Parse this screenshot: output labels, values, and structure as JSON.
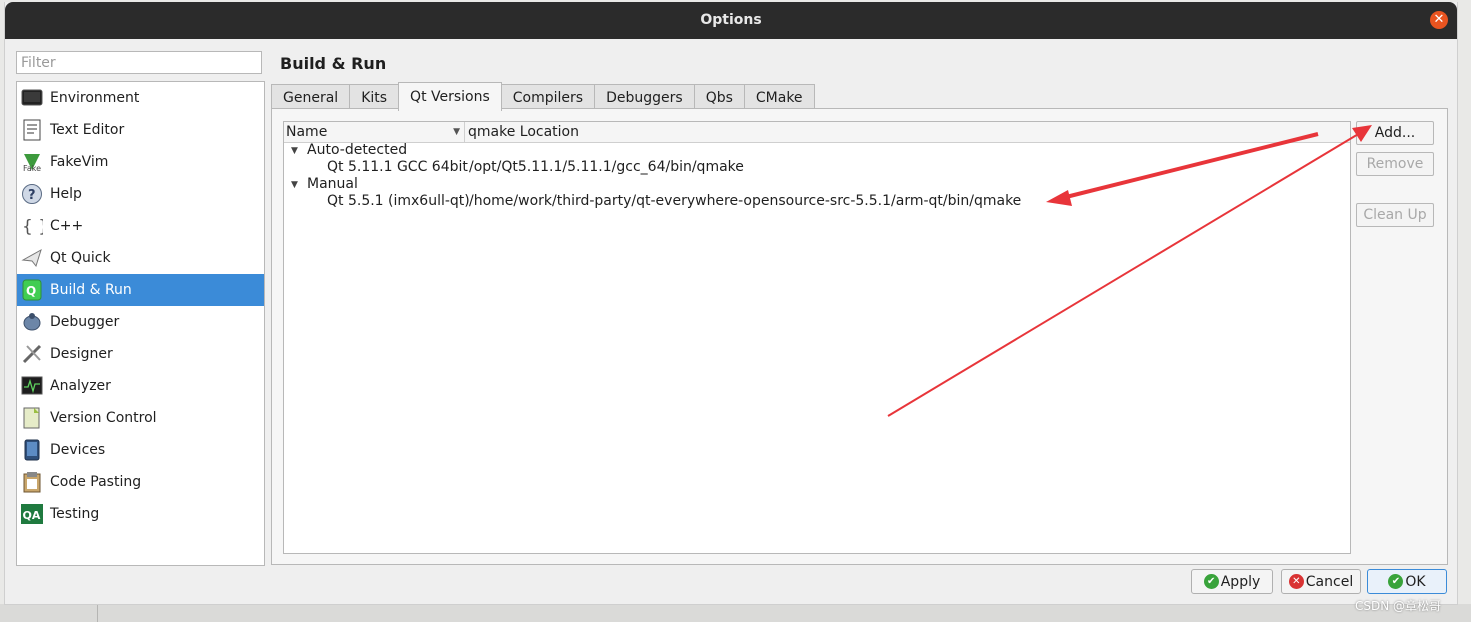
{
  "window": {
    "title": "Options"
  },
  "filter": {
    "placeholder": "Filter"
  },
  "nav": {
    "items": [
      {
        "label": "Environment",
        "icon": "monitor-icon"
      },
      {
        "label": "Text Editor",
        "icon": "text-document-icon"
      },
      {
        "label": "FakeVim",
        "icon": "fakevim-icon"
      },
      {
        "label": "Help",
        "icon": "help-icon"
      },
      {
        "label": "C++",
        "icon": "braces-icon"
      },
      {
        "label": "Qt Quick",
        "icon": "paper-plane-icon"
      },
      {
        "label": "Build & Run",
        "icon": "qt-build-icon"
      },
      {
        "label": "Debugger",
        "icon": "bug-icon"
      },
      {
        "label": "Designer",
        "icon": "drafting-tools-icon"
      },
      {
        "label": "Analyzer",
        "icon": "oscilloscope-icon"
      },
      {
        "label": "Version Control",
        "icon": "version-control-icon"
      },
      {
        "label": "Devices",
        "icon": "device-icon"
      },
      {
        "label": "Code Pasting",
        "icon": "clipboard-icon"
      },
      {
        "label": "Testing",
        "icon": "qa-icon"
      }
    ],
    "selected": "Build & Run"
  },
  "page": {
    "title": "Build & Run"
  },
  "tabs": [
    "General",
    "Kits",
    "Qt Versions",
    "Compilers",
    "Debuggers",
    "Qbs",
    "CMake"
  ],
  "active_tab": "Qt Versions",
  "tree": {
    "columns": {
      "name": "Name",
      "location": "qmake Location"
    },
    "groups": [
      {
        "label": "Auto-detected",
        "rows": [
          {
            "name": "Qt 5.11.1 GCC 64bit",
            "location": "/opt/Qt5.11.1/5.11.1/gcc_64/bin/qmake"
          }
        ]
      },
      {
        "label": "Manual",
        "rows": [
          {
            "name": "Qt 5.5.1 (imx6ull-qt)",
            "location": "/home/work/third-party/qt-everywhere-opensource-src-5.5.1/arm-qt/bin/qmake"
          }
        ]
      }
    ]
  },
  "buttons": {
    "add": "Add...",
    "remove": "Remove",
    "clean_up": "Clean Up"
  },
  "dialog_buttons": {
    "apply": "Apply",
    "cancel": "Cancel",
    "ok": "OK"
  },
  "watermark": "CSDN @章松哥",
  "colors": {
    "selection": "#3b8bd8",
    "arrow": "#e8353a",
    "titlebar": "#2b2b2b",
    "close": "#e95420"
  }
}
